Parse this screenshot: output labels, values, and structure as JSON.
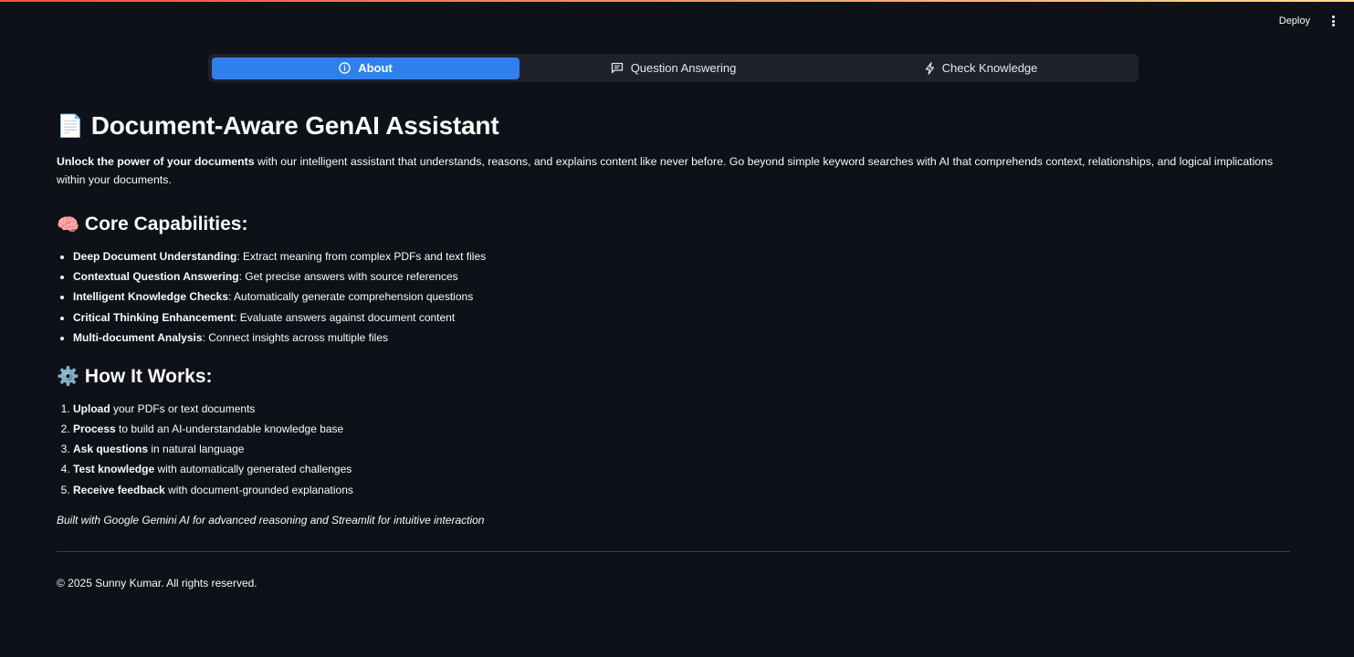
{
  "header": {
    "deploy_label": "Deploy"
  },
  "tabs": [
    {
      "label": "About",
      "icon": "info-circle-icon",
      "active": true
    },
    {
      "label": "Question Answering",
      "icon": "chat-icon",
      "active": false
    },
    {
      "label": "Check Knowledge",
      "icon": "lightning-icon",
      "active": false
    }
  ],
  "main": {
    "title": "Document-Aware GenAI Assistant",
    "title_icon": "📄",
    "intro_bold": "Unlock the power of your documents",
    "intro_rest": " with our intelligent assistant that understands, reasons, and explains content like never before. Go beyond simple keyword searches with AI that comprehends context, relationships, and logical implications within your documents.",
    "capabilities": {
      "heading": "Core Capabilities:",
      "icon": "🧠",
      "items": [
        {
          "bold": "Deep Document Understanding",
          "text": ": Extract meaning from complex PDFs and text files"
        },
        {
          "bold": "Contextual Question Answering",
          "text": ": Get precise answers with source references"
        },
        {
          "bold": "Intelligent Knowledge Checks",
          "text": ": Automatically generate comprehension questions"
        },
        {
          "bold": "Critical Thinking Enhancement",
          "text": ": Evaluate answers against document content"
        },
        {
          "bold": "Multi-document Analysis",
          "text": ": Connect insights across multiple files"
        }
      ]
    },
    "how": {
      "heading": "How It Works:",
      "icon": "⚙️",
      "steps": [
        {
          "bold": "Upload",
          "text": " your PDFs or text documents"
        },
        {
          "bold": "Process",
          "text": " to build an AI-understandable knowledge base"
        },
        {
          "bold": "Ask questions",
          "text": " in natural language"
        },
        {
          "bold": "Test knowledge",
          "text": " with automatically generated challenges"
        },
        {
          "bold": "Receive feedback",
          "text": " with document-grounded explanations"
        }
      ]
    },
    "footer_note": "Built with Google Gemini AI for advanced reasoning and Streamlit for intuitive interaction",
    "copyright": "© 2025 Sunny Kumar. All rights reserved."
  },
  "colors": {
    "background": "#0e1117",
    "active_tab": "#2f80ed",
    "tabbar": "#1f222b"
  }
}
